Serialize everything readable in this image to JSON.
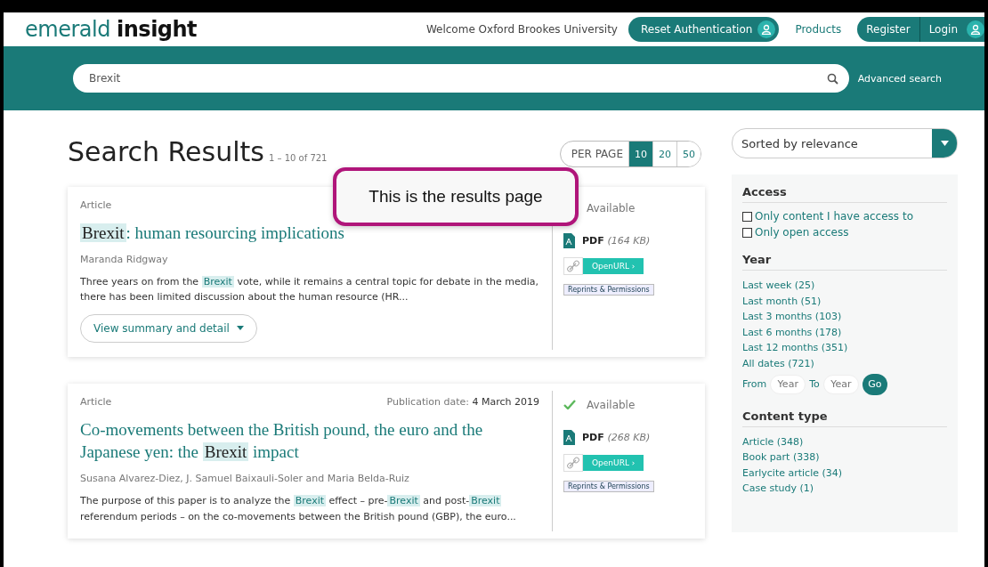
{
  "header": {
    "logo_light": "emerald",
    "logo_bold": "insight",
    "welcome": "Welcome Oxford Brookes University",
    "reset_button": "Reset Authentication",
    "products": "Products",
    "register": "Register",
    "login": "Login"
  },
  "search": {
    "value": "Brexit",
    "advanced": "Advanced search"
  },
  "results_header": {
    "title": "Search Results",
    "count": "1 – 10 of 721",
    "per_page_label": "PER PAGE",
    "per_page": [
      {
        "label": "10",
        "selected": true
      },
      {
        "label": "20",
        "selected": false
      },
      {
        "label": "50",
        "selected": false
      }
    ]
  },
  "sort": {
    "value": "Sorted by relevance"
  },
  "callout": "This is the results page",
  "results": [
    {
      "type": "Article",
      "title_parts": [
        {
          "text": "Brexit",
          "highlight": true
        },
        {
          "text": ": human resourcing implications",
          "highlight": false
        }
      ],
      "authors": "Maranda Ridgway",
      "snippet_parts": [
        {
          "text": "Three years on from the ",
          "highlight": false
        },
        {
          "text": "Brexit",
          "highlight": true
        },
        {
          "text": " vote, while it remains a central topic for debate in the media, there has been limited discussion about the human resource (HR...",
          "highlight": false
        }
      ],
      "summary_button": "View summary and detail",
      "available": "Available",
      "check_icon": false,
      "pdf": "PDF",
      "pdf_size": "(164 KB)",
      "openurl": "OpenURL ›",
      "reprints": "Reprints & Permissions"
    },
    {
      "type": "Article",
      "date_label": "Publication date:",
      "date": "4 March 2019",
      "title_parts": [
        {
          "text": "Co-movements between the British pound, the euro and the Japanese yen: the ",
          "highlight": false
        },
        {
          "text": "Brexit",
          "highlight": true
        },
        {
          "text": " impact",
          "highlight": false
        }
      ],
      "authors": "Susana Alvarez-Diez, J. Samuel Baixauli-Soler and Maria Belda-Ruiz",
      "snippet_parts": [
        {
          "text": "The purpose of this paper is to analyze the ",
          "highlight": false
        },
        {
          "text": "Brexit",
          "highlight": true
        },
        {
          "text": " effect – pre-",
          "highlight": false
        },
        {
          "text": "Brexit",
          "highlight": true
        },
        {
          "text": " and post-",
          "highlight": false
        },
        {
          "text": "Brexit",
          "highlight": true
        },
        {
          "text": " referendum periods – on the co-movements between the British pound (GBP), the euro...",
          "highlight": false
        }
      ],
      "available": "Available",
      "check_icon": true,
      "pdf": "PDF",
      "pdf_size": "(268 KB)",
      "openurl": "OpenURL ›",
      "reprints": "Reprints & Permissions"
    }
  ],
  "filters": {
    "access": {
      "title": "Access",
      "options": [
        {
          "label": "Only content I have access to",
          "checked": false
        },
        {
          "label": "Only open access",
          "checked": false
        }
      ]
    },
    "year": {
      "title": "Year",
      "links": [
        "Last week (25)",
        "Last month (51)",
        "Last 3 months (103)",
        "Last 6 months (178)",
        "Last 12 months (351)",
        "All dates (721)"
      ],
      "from": "From",
      "to": "To",
      "from_placeholder": "Year",
      "to_placeholder": "Year",
      "go": "Go"
    },
    "content_type": {
      "title": "Content type",
      "links": [
        "Article (348)",
        "Book part (338)",
        "Earlycite article (34)",
        "Case study (1)"
      ]
    }
  }
}
